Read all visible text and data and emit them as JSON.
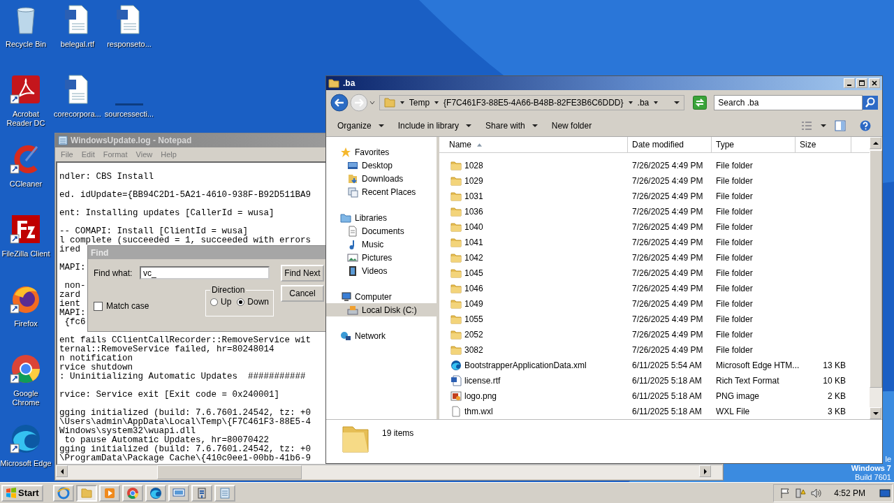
{
  "desktop": {
    "icon_columns": [
      [
        {
          "kind": "recycle",
          "label": "Recycle Bin",
          "shortcut": false
        },
        {
          "kind": "acrobat",
          "label": "Acrobat Reader DC",
          "shortcut": true
        },
        {
          "kind": "ccleaner",
          "label": "CCleaner",
          "shortcut": true
        },
        {
          "kind": "filezilla",
          "label": "FileZilla Client",
          "shortcut": true
        },
        {
          "kind": "firefox",
          "label": "Firefox",
          "shortcut": true
        },
        {
          "kind": "chrome",
          "label": "Google Chrome",
          "shortcut": true
        },
        {
          "kind": "edge",
          "label": "Microsoft Edge",
          "shortcut": true
        }
      ],
      [
        {
          "kind": "word",
          "label": "belegal.rtf",
          "shortcut": false
        },
        {
          "kind": "word",
          "label": "corecorpora...",
          "shortcut": false
        }
      ],
      [
        {
          "kind": "word",
          "label": "responseto...",
          "shortcut": false
        },
        {
          "kind": "blank",
          "label": "sourcessecti...",
          "shortcut": false
        }
      ]
    ],
    "corner_texts": [
      "le",
      "Windows 7",
      "Build 7601"
    ]
  },
  "notepad": {
    "title": "WindowsUpdate.log - Notepad",
    "active": false,
    "menu": [
      "File",
      "Edit",
      "Format",
      "View",
      "Help"
    ],
    "lines": [
      {
        "kind": "text",
        "text": "ndler: CBS Install"
      },
      {
        "kind": "blank"
      },
      {
        "kind": "text",
        "text": "ed. idUpdate={BB94C2D1-5A21-4610-938F-B92D511BA9"
      },
      {
        "kind": "blank"
      },
      {
        "kind": "text",
        "text": "ent: Installing updates [CallerId = wusa]"
      },
      {
        "kind": "blank"
      },
      {
        "kind": "text",
        "text": "-- COMAPI: Install [ClientId = wusa]"
      },
      {
        "kind": "text",
        "text": "l complete (succeeded = 1, succeeded with errors"
      },
      {
        "kind": "text",
        "text": "ired"
      },
      {
        "kind": "blank"
      },
      {
        "kind": "text",
        "text": "MAPI:"
      },
      {
        "kind": "blank"
      },
      {
        "kind": "text",
        "text": " non-"
      },
      {
        "kind": "text",
        "text": "zard"
      },
      {
        "kind": "text",
        "text": "ient"
      },
      {
        "kind": "text",
        "text": "MAPI:"
      },
      {
        "kind": "text",
        "text": " {fc6"
      },
      {
        "kind": "blank"
      },
      {
        "kind": "text",
        "text": "ent fails CClientCallRecorder::RemoveService wit"
      },
      {
        "kind": "text",
        "text": "ternal::RemoveService failed, hr=80248014"
      },
      {
        "kind": "text",
        "text": "n notification"
      },
      {
        "kind": "text",
        "text": "rvice shutdown"
      },
      {
        "kind": "text",
        "text": ": Uninitializing Automatic Updates  ###########"
      },
      {
        "kind": "blank"
      },
      {
        "kind": "text",
        "text": "rvice: Service exit [Exit code = 0x240001]"
      },
      {
        "kind": "blank"
      },
      {
        "kind": "text",
        "text": "gging initialized (build: 7.6.7601.24542, tz: +0"
      },
      {
        "kind": "text",
        "text": "\\Users\\admin\\AppData\\Local\\Temp\\{F7C461F3-88E5-4"
      },
      {
        "kind": "text",
        "text": "Windows\\system32\\wuapi.dll"
      },
      {
        "kind": "text",
        "text": " to pause Automatic Updates, hr=80070422"
      },
      {
        "kind": "text",
        "text": "gging initialized (build: 7.6.7601.24542, tz: +0"
      },
      {
        "kind": "text",
        "text": "\\ProgramData\\Package Cache\\{410c0ee1-00bb-41b6-9"
      }
    ]
  },
  "find_dialog": {
    "title": "Find",
    "find_what_label": "Find what:",
    "find_what_value": "vc_",
    "find_next": "Find Next",
    "cancel": "Cancel",
    "match_case": {
      "label": "Match case",
      "checked": false
    },
    "direction": {
      "label": "Direction",
      "options": [
        {
          "label": "Up",
          "selected": false
        },
        {
          "label": "Down",
          "selected": true
        }
      ]
    }
  },
  "explorer": {
    "title": ".ba",
    "active": true,
    "breadcrumbs": [
      "Temp",
      "{F7C461F3-88E5-4A66-B48B-82FE3B6C6DDD}",
      ".ba"
    ],
    "search": {
      "placeholder": "Search .ba"
    },
    "toolbar": [
      {
        "label": "Organize",
        "dropdown": true
      },
      {
        "label": "Include in library",
        "dropdown": true
      },
      {
        "label": "Share with",
        "dropdown": true
      },
      {
        "label": "New folder",
        "dropdown": false
      }
    ],
    "nav": [
      {
        "kind": "favorites",
        "label": "Favorites",
        "selected": false,
        "children": [
          {
            "kind": "desktop",
            "label": "Desktop",
            "selected": false
          },
          {
            "kind": "downloads",
            "label": "Downloads",
            "selected": false
          },
          {
            "kind": "recent",
            "label": "Recent Places",
            "selected": false
          }
        ]
      },
      {
        "kind": "libraries",
        "label": "Libraries",
        "selected": false,
        "children": [
          {
            "kind": "documents",
            "label": "Documents",
            "selected": false
          },
          {
            "kind": "music",
            "label": "Music",
            "selected": false
          },
          {
            "kind": "pictures",
            "label": "Pictures",
            "selected": false
          },
          {
            "kind": "videos",
            "label": "Videos",
            "selected": false
          }
        ]
      },
      {
        "kind": "computer",
        "label": "Computer",
        "selected": false,
        "children": [
          {
            "kind": "disk",
            "label": "Local Disk (C:)",
            "selected": true
          }
        ]
      },
      {
        "kind": "network",
        "label": "Network",
        "selected": false
      }
    ],
    "columns": [
      {
        "label": "Name",
        "sorted": true
      },
      {
        "label": "Date modified",
        "sorted": false
      },
      {
        "label": "Type",
        "sorted": false
      },
      {
        "label": "Size",
        "sorted": false
      }
    ],
    "rows": [
      {
        "kind": "folder",
        "name": "1028",
        "date": "7/26/2025 4:49 PM",
        "type": "File folder",
        "selected": false
      },
      {
        "kind": "folder",
        "name": "1029",
        "date": "7/26/2025 4:49 PM",
        "type": "File folder",
        "selected": false
      },
      {
        "kind": "folder",
        "name": "1031",
        "date": "7/26/2025 4:49 PM",
        "type": "File folder",
        "selected": false
      },
      {
        "kind": "folder",
        "name": "1036",
        "date": "7/26/2025 4:49 PM",
        "type": "File folder",
        "selected": false
      },
      {
        "kind": "folder",
        "name": "1040",
        "date": "7/26/2025 4:49 PM",
        "type": "File folder",
        "selected": false
      },
      {
        "kind": "folder",
        "name": "1041",
        "date": "7/26/2025 4:49 PM",
        "type": "File folder",
        "selected": false
      },
      {
        "kind": "folder",
        "name": "1042",
        "date": "7/26/2025 4:49 PM",
        "type": "File folder",
        "selected": false
      },
      {
        "kind": "folder",
        "name": "1045",
        "date": "7/26/2025 4:49 PM",
        "type": "File folder",
        "selected": false
      },
      {
        "kind": "folder",
        "name": "1046",
        "date": "7/26/2025 4:49 PM",
        "type": "File folder",
        "selected": false
      },
      {
        "kind": "folder",
        "name": "1049",
        "date": "7/26/2025 4:49 PM",
        "type": "File folder",
        "selected": false
      },
      {
        "kind": "folder",
        "name": "1055",
        "date": "7/26/2025 4:49 PM",
        "type": "File folder",
        "selected": false
      },
      {
        "kind": "folder",
        "name": "2052",
        "date": "7/26/2025 4:49 PM",
        "type": "File folder",
        "selected": false
      },
      {
        "kind": "folder",
        "name": "3082",
        "date": "7/26/2025 4:49 PM",
        "type": "File folder",
        "selected": false
      },
      {
        "kind": "edge",
        "name": "BootstrapperApplicationData.xml",
        "date": "6/11/2025 5:54 AM",
        "type": "Microsoft Edge HTM...",
        "size": "13 KB",
        "selected": false
      },
      {
        "kind": "word",
        "name": "license.rtf",
        "date": "6/11/2025 5:18 AM",
        "type": "Rich Text Format",
        "size": "10 KB",
        "selected": false
      },
      {
        "kind": "image",
        "name": "logo.png",
        "date": "6/11/2025 5:18 AM",
        "type": "PNG image",
        "size": "2 KB",
        "selected": false
      },
      {
        "kind": "file",
        "name": "thm.wxl",
        "date": "6/11/2025 5:18 AM",
        "type": "WXL File",
        "size": "3 KB",
        "selected": false
      }
    ],
    "status": "19 items"
  },
  "taskbar": {
    "start": "Start",
    "apps": [
      {
        "kind": "ie",
        "active": false
      },
      {
        "kind": "explorer",
        "active": true
      },
      {
        "kind": "media",
        "active": false
      },
      {
        "kind": "chrome",
        "active": false
      },
      {
        "kind": "edge",
        "active": false
      },
      {
        "kind": "monitor",
        "active": false
      },
      {
        "kind": "tool",
        "active": false
      },
      {
        "kind": "notepad",
        "active": false
      }
    ],
    "time": "4:52 PM"
  }
}
